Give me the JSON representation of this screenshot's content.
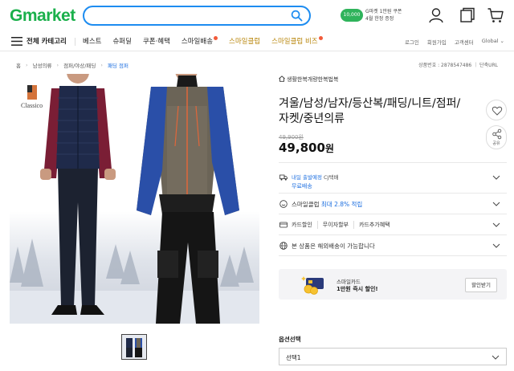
{
  "header": {
    "logo_g": "G",
    "logo_rest": "market",
    "search": {
      "value": "",
      "placeholder": ""
    },
    "promo": {
      "badge": "10,000",
      "line1": "G마켓 1만원 쿠폰",
      "line2": "4월 한정 증정"
    },
    "icons": [
      "user-icon",
      "recent-view-icon",
      "cart-icon"
    ]
  },
  "nav": {
    "all_categories": "전체 카테고리",
    "items": [
      {
        "label": "베스트",
        "type": "normal",
        "dot": false
      },
      {
        "label": "슈퍼딜",
        "type": "normal",
        "dot": false
      },
      {
        "label": "쿠폰·혜택",
        "type": "normal",
        "dot": false
      },
      {
        "label": "스마일배송",
        "type": "normal",
        "dot": true
      },
      {
        "label": "스마일클럽",
        "type": "smile",
        "dot": false
      },
      {
        "label": "스마일클럽 비즈",
        "type": "smile",
        "dot": true
      }
    ],
    "util": [
      "로그인",
      "회원가입",
      "고객센터",
      "Global ⌄"
    ]
  },
  "breadcrumb": {
    "items": [
      "홈",
      "남성의류",
      "점퍼/야상/패딩",
      "패딩 점퍼"
    ],
    "product_no": "상품번호 : 2878547486 ｜ 단축URL"
  },
  "gallery": {
    "brand_mark": "Classico"
  },
  "product": {
    "store": "생활한복개량한복법복",
    "title": "겨울/남성/남자/등산복/패딩/니트/점퍼/자켓/중년의류",
    "original_price": "49,900원",
    "price": "49,800",
    "price_unit": "원",
    "share_label": "공유",
    "shipping_line1": "내일 출발예정",
    "shipping_carrier": "CJ택배",
    "shipping_line2": "무료배송",
    "smile_club_prefix": "스마일클럽",
    "smile_club_value": "최대 2.8% 적립",
    "card_tabs": [
      "카드할인",
      "무이자할부",
      "카드추가혜택"
    ],
    "overseas": "본 상품은 해외배송이 가능합니다",
    "smile_card": {
      "title": "스마일카드",
      "subtitle": "1만원 즉시 할인!",
      "button": "할인받기"
    },
    "option_label": "옵션선택",
    "option_value": "선택1"
  },
  "colors": {
    "brand_green": "#1ab04b",
    "search_blue": "#1d8cf0",
    "link_blue": "#1d6fe0"
  }
}
